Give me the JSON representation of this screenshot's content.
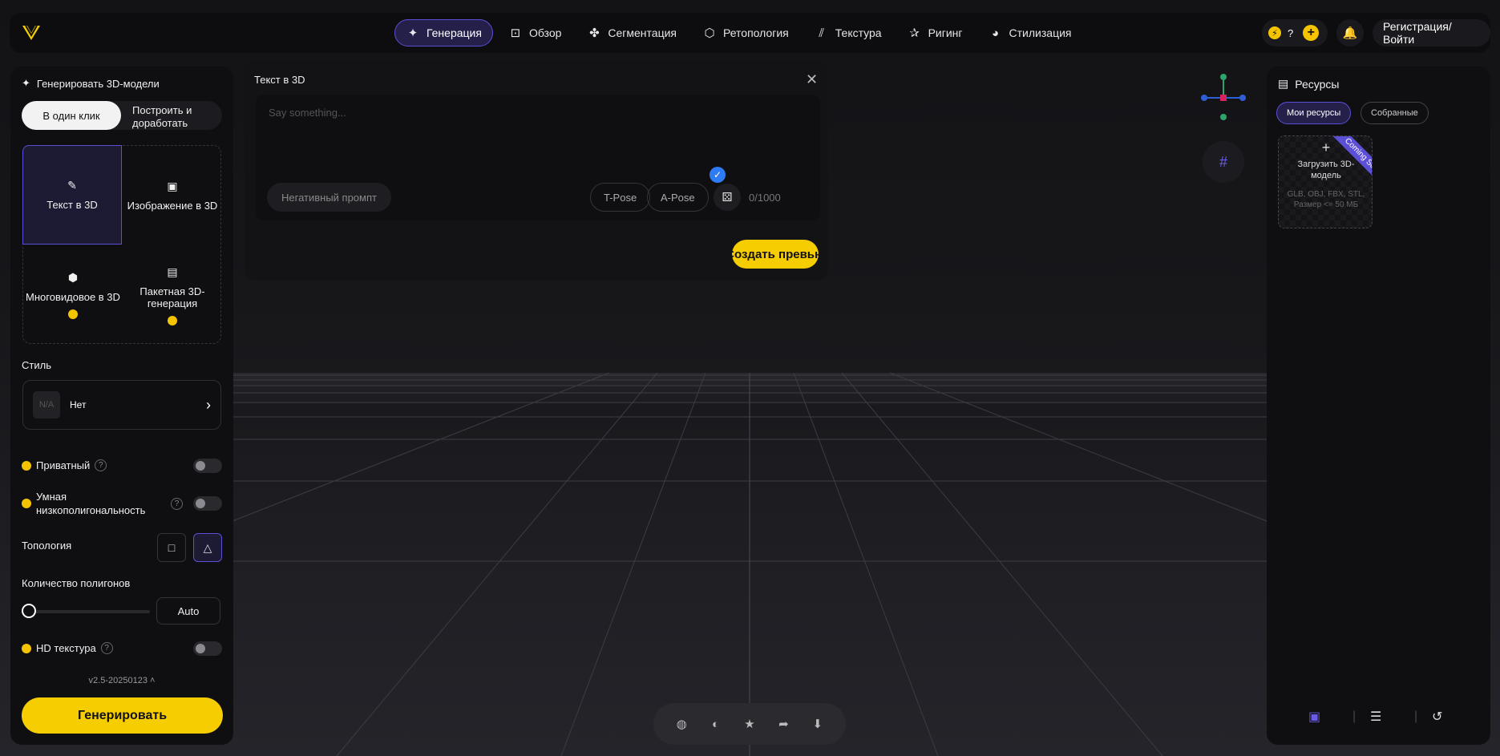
{
  "nav": {
    "items": [
      {
        "label": "Генерация",
        "icon": "sparkle-icon",
        "glyph": "✦",
        "active": true
      },
      {
        "label": "Обзор",
        "icon": "scan-icon",
        "glyph": "⊡",
        "active": false
      },
      {
        "label": "Сегментация",
        "icon": "puzzle-icon",
        "glyph": "✤",
        "active": false
      },
      {
        "label": "Ретопология",
        "icon": "mesh-icon",
        "glyph": "⬡",
        "active": false
      },
      {
        "label": "Текстура",
        "icon": "texture-icon",
        "glyph": "⫽",
        "active": false
      },
      {
        "label": "Ригинг",
        "icon": "rig-icon",
        "glyph": "✰",
        "active": false
      },
      {
        "label": "Стилизация",
        "icon": "palette-icon",
        "glyph": "◕",
        "active": false
      }
    ],
    "credits_value": "?",
    "login_label": "Регистрация/Войти"
  },
  "left": {
    "title": "Генерировать 3D-модели",
    "mode_one_click": "В один клик",
    "mode_build": "Построить и доработать",
    "types": [
      {
        "label": "Текст в 3D",
        "icon": "pencil-icon",
        "glyph": "✎"
      },
      {
        "label": "Изображение в 3D",
        "icon": "image-icon",
        "glyph": "▣"
      },
      {
        "label": "Многовидовое в 3D",
        "icon": "multiview-icon",
        "glyph": "⬢"
      },
      {
        "label": "Пакетная 3D-генерация",
        "icon": "batch-icon",
        "glyph": "▤"
      }
    ],
    "style_label": "Стиль",
    "style_thumb": "N/A",
    "style_value": "Нет",
    "private_label": "Приватный",
    "lowpoly_label": "Умная низкополигональность",
    "topology_label": "Топология",
    "polycount_label": "Количество полигонов",
    "polycount_value": "Auto",
    "hd_label": "HD текстура",
    "version": "v2.5-20250123",
    "generate_label": "Генерировать"
  },
  "t3d": {
    "title": "Текст в 3D",
    "placeholder": "Say something...",
    "negative_label": "Негативный промпт",
    "tpose_label": "T-Pose",
    "apose_label": "A-Pose",
    "counter": "0/1000",
    "preview_label": "Создать превью"
  },
  "right": {
    "title": "Ресурсы",
    "tab_mine": "Мои ресурсы",
    "tab_collected": "Собранные",
    "upload_title": "Загрузить 3D-модель",
    "upload_desc": "GLB, OBJ, FBX, STL, Размер <= 50 МБ",
    "ribbon": "Coming Soon"
  },
  "colors": {
    "accent": "#5b4fd6",
    "brand_yellow": "#f5cd00"
  }
}
